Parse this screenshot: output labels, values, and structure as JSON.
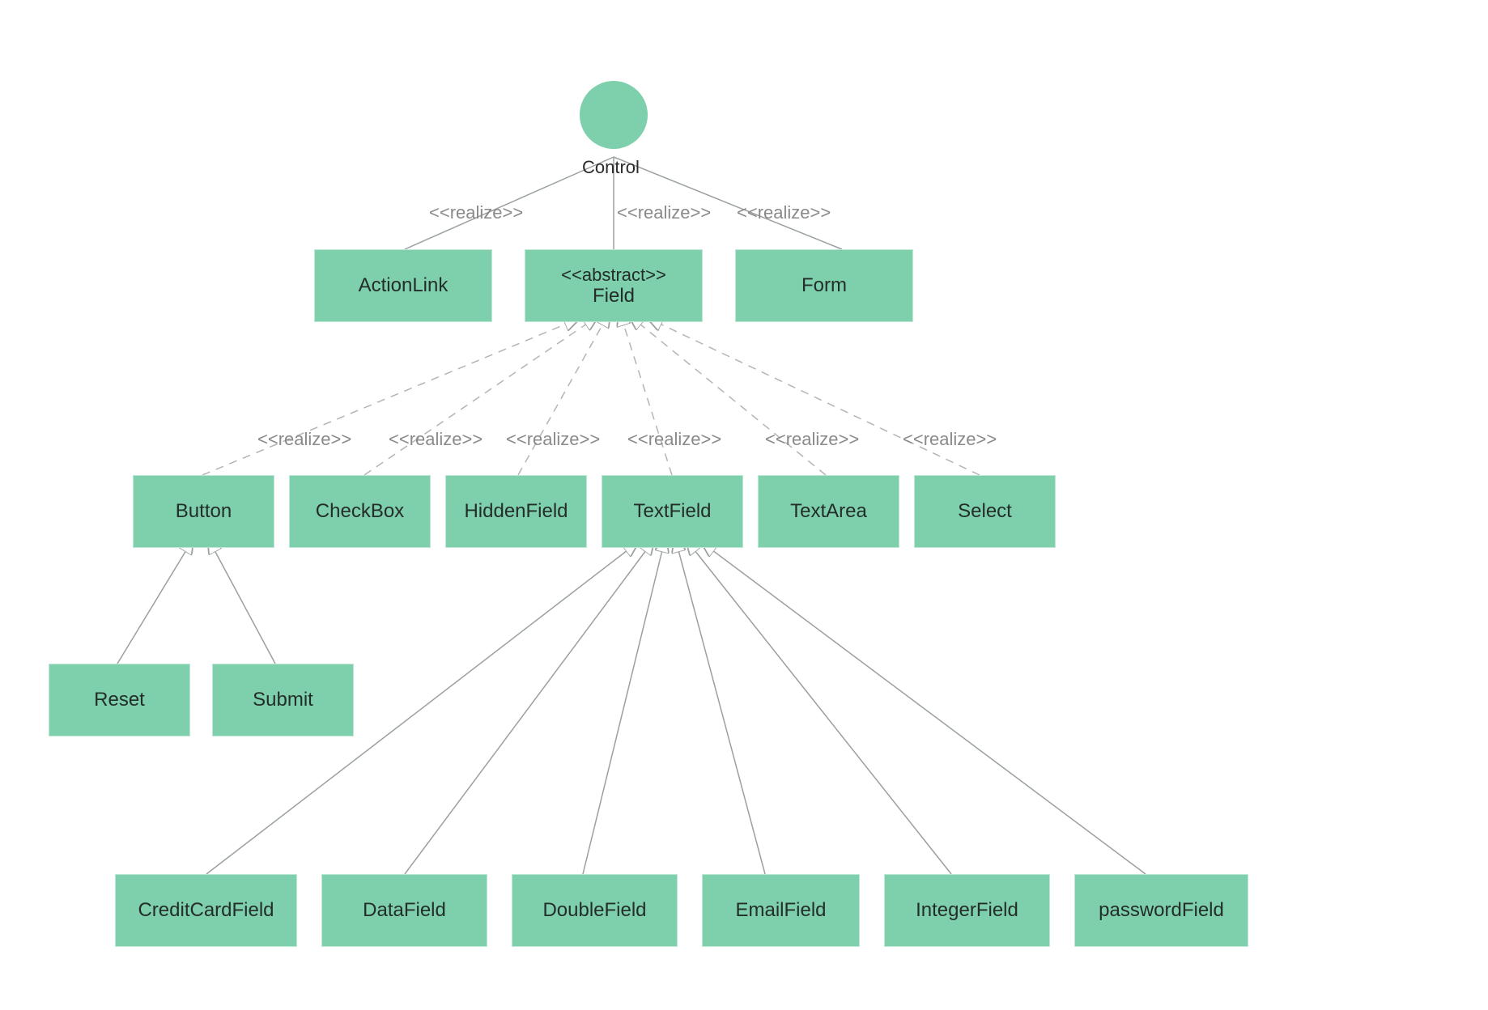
{
  "colors": {
    "node_fill": "#7ecfab",
    "line": "#9aa0a0",
    "dashed": "#b4b4b4",
    "label_gray": "#8a8a8a"
  },
  "root": {
    "label": "Control"
  },
  "stereotype": {
    "realize": "<<realize>>",
    "abstract": "<<abstract>>"
  },
  "level1": {
    "actionLink": "ActionLink",
    "field": "Field",
    "form": "Form"
  },
  "level2": {
    "button": "Button",
    "checkBox": "CheckBox",
    "hiddenField": "HiddenField",
    "textField": "TextField",
    "textArea": "TextArea",
    "select": "Select"
  },
  "level3button": {
    "reset": "Reset",
    "submit": "Submit"
  },
  "level3textfield": {
    "creditCardField": "CreditCardField",
    "dataField": "DataField",
    "doubleField": "DoubleField",
    "emailField": "EmailField",
    "integerField": "IntegerField",
    "passwordField": "passwordField"
  }
}
